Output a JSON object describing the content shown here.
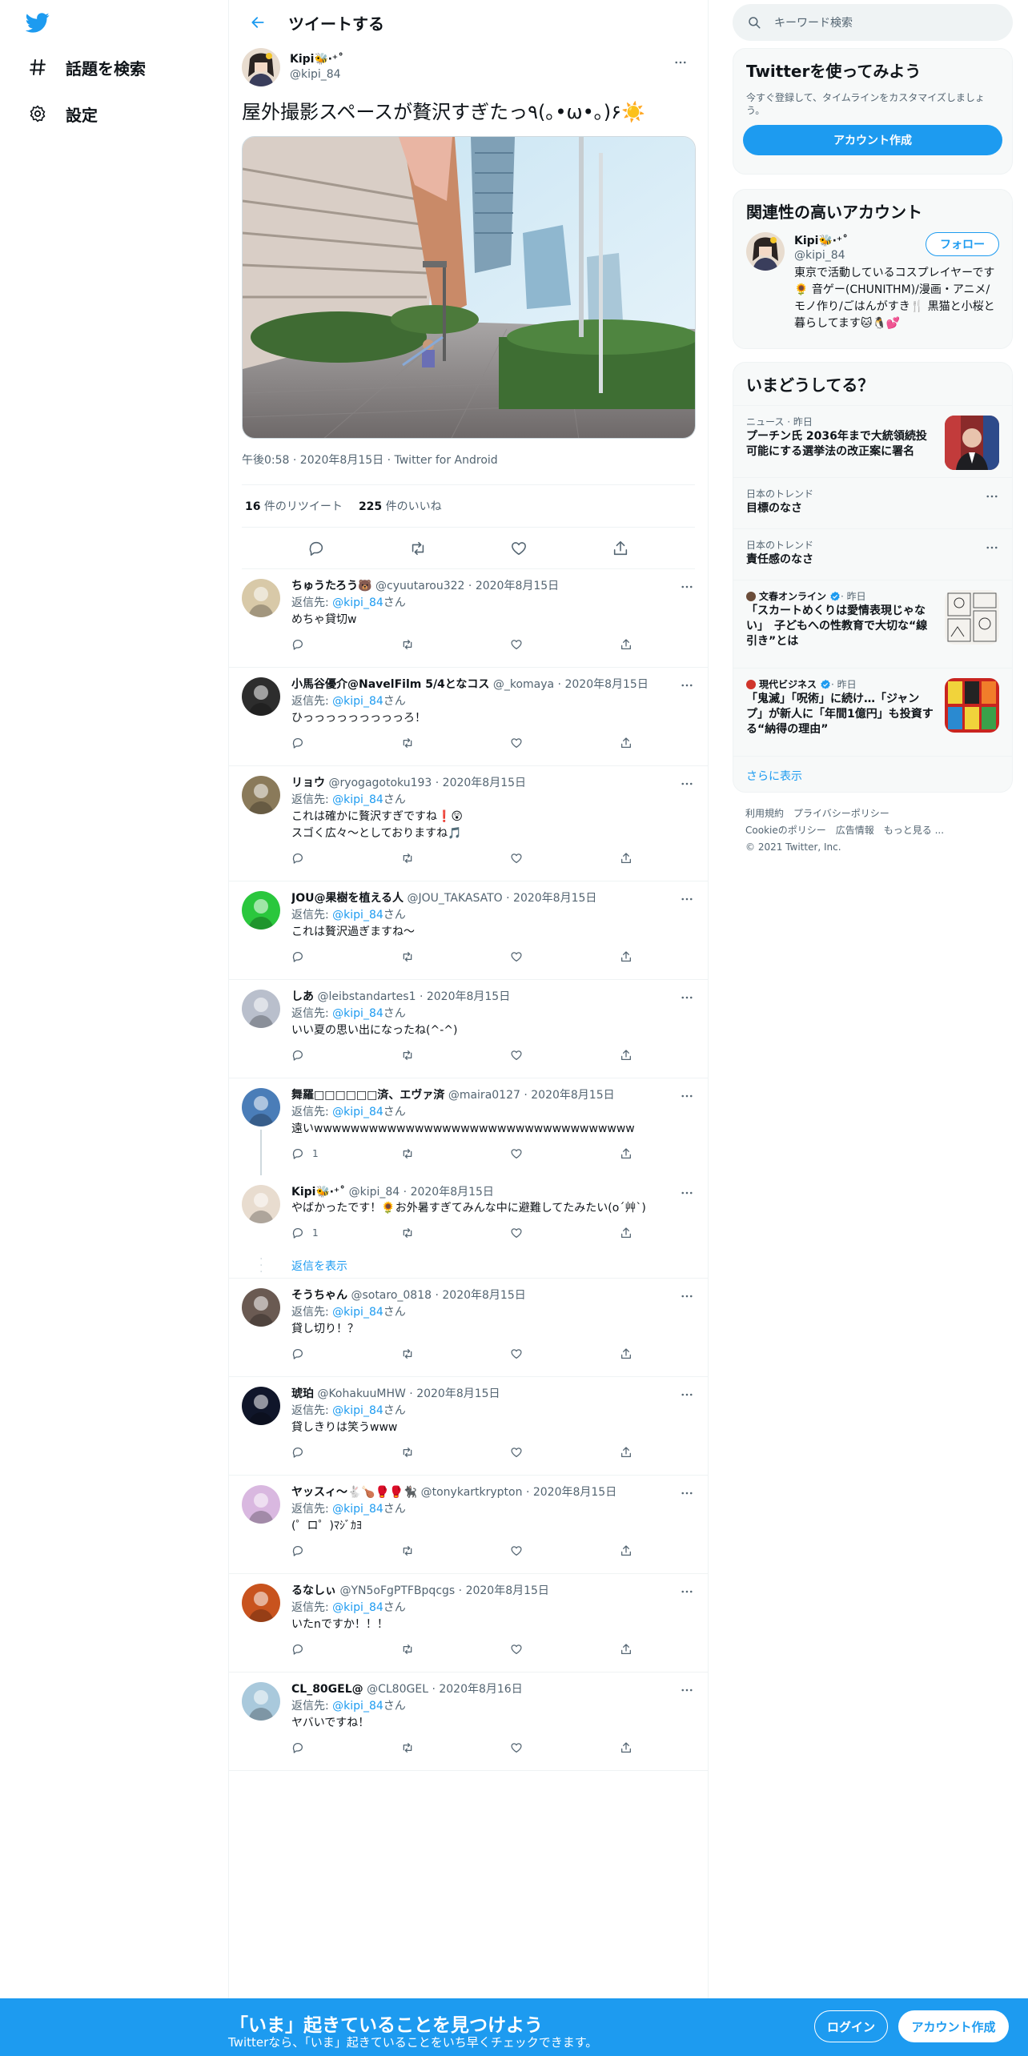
{
  "nav": {
    "logo_icon": "twitter-bird-icon",
    "explore_label": "話題を検索",
    "settings_label": "設定"
  },
  "header": {
    "title": "ツイートする"
  },
  "tweet": {
    "author_name": "Kipi🐝‧⁺˚",
    "author_handle": "@kipi_84",
    "text": "屋外撮影スペースが贅沢すぎたっ٩(｡•ω•｡)۶☀️",
    "meta": "午後0:58 · 2020年8月15日 · Twitter for Android",
    "retweet_count": "16",
    "retweet_label": " 件のリツイート",
    "like_count": "225",
    "like_label": " 件のいいね"
  },
  "replies": [
    {
      "name": "ちゅうたろう🐻",
      "handle": "@cyuutarou322",
      "date": "2020年8月15日",
      "to_prefix": "返信先: ",
      "to_link": "@kipi_84",
      "to_suffix": "さん",
      "text": "めちゃ貸切w",
      "reply_count": ""
    },
    {
      "name": "小馬谷優介@NavelFilm 5/4となコス",
      "handle": "@_komaya",
      "date": "2020年8月15日",
      "to_prefix": "返信先: ",
      "to_link": "@kipi_84",
      "to_suffix": "さん",
      "text": "ひっっっっっっっっっろ！",
      "reply_count": ""
    },
    {
      "name": "リョウ",
      "handle": "@ryogagotoku193",
      "date": "2020年8月15日",
      "to_prefix": "返信先: ",
      "to_link": "@kipi_84",
      "to_suffix": "さん",
      "text": "これは確かに贅沢すぎですね❗😲\nスゴく広々～としておりますね🎵",
      "reply_count": ""
    },
    {
      "name": "JOU@果樹を植える人",
      "handle": "@JOU_TAKASATO",
      "date": "2020年8月15日",
      "to_prefix": "返信先: ",
      "to_link": "@kipi_84",
      "to_suffix": "さん",
      "text": "これは贅沢過ぎますね〜",
      "reply_count": ""
    },
    {
      "name": "しあ",
      "handle": "@leibstandartes1",
      "date": "2020年8月15日",
      "to_prefix": "返信先: ",
      "to_link": "@kipi_84",
      "to_suffix": "さん",
      "text": "いい夏の思い出になったね(^-^)",
      "reply_count": ""
    },
    {
      "name": "舞羅□□□□□□済、エヴァ済",
      "handle": "@maira0127",
      "date": "2020年8月15日",
      "to_prefix": "返信先: ",
      "to_link": "@kipi_84",
      "to_suffix": "さん",
      "text": "遠いwwwwwwwwwwwwwwwwwwwwwwwwwwwwwwwwwww",
      "reply_count": "1"
    },
    {
      "name": "Kipi🐝‧⁺˚",
      "handle": "@kipi_84",
      "date": "2020年8月15日",
      "to_prefix": "",
      "to_link": "",
      "to_suffix": "",
      "text": "やばかったです！🌻お外暑すぎてみんな中に避難してたみたい(o´艸`)",
      "reply_count": "1"
    },
    {
      "name": "そうちゃん",
      "handle": "@sotaro_0818",
      "date": "2020年8月15日",
      "to_prefix": "返信先: ",
      "to_link": "@kipi_84",
      "to_suffix": "さん",
      "text": "貸し切り！？",
      "reply_count": ""
    },
    {
      "name": "琥珀",
      "handle": "@KohakuuMHW",
      "date": "2020年8月15日",
      "to_prefix": "返信先: ",
      "to_link": "@kipi_84",
      "to_suffix": "さん",
      "text": "貸しきりは笑うwww",
      "reply_count": ""
    },
    {
      "name": "ヤッスィ～🐇🍗🥊🥊🐈‍⬛",
      "handle": "@tonykartkrypton",
      "date": "2020年8月15日",
      "to_prefix": "返信先: ",
      "to_link": "@kipi_84",
      "to_suffix": "さん",
      "text": "(゜ロ゜)ﾏｼﾞｶﾖ",
      "reply_count": ""
    },
    {
      "name": "るなしぃ",
      "handle": "@YN5oFgPTFBpqcgs",
      "date": "2020年8月15日",
      "to_prefix": "返信先: ",
      "to_link": "@kipi_84",
      "to_suffix": "さん",
      "text": "いたnですか！！！",
      "reply_count": ""
    },
    {
      "name": "CL_80GEL@",
      "handle": "@CL80GEL",
      "date": "2020年8月16日",
      "to_prefix": "返信先: ",
      "to_link": "@kipi_84",
      "to_suffix": "さん",
      "text": "ヤバいですね！",
      "reply_count": ""
    }
  ],
  "show_replies_label": "返信を表示",
  "search": {
    "placeholder": "キーワード検索"
  },
  "signup_panel": {
    "title": "Twitterを使ってみよう",
    "desc": "今すぐ登録して、タイムラインをカスタマイズしましょう。",
    "button": "アカウント作成"
  },
  "related": {
    "title": "関連性の高いアカウント",
    "name": "Kipi🐝‧⁺˚",
    "handle": "@kipi_84",
    "bio": "東京で活動しているコスプレイヤーです🌻 音ゲー(CHUNITHM)/漫画・アニメ/モノ作り/ごはんがすき🍴 黒猫と小桜と暮らしてます🐱🐧💕",
    "follow": "フォロー"
  },
  "trends": {
    "title": "いまどうしてる？",
    "items": [
      {
        "meta": "ニュース · 昨日",
        "title": "プーチン氏 2036年まで大統領続投可能にする選挙法の改正案に署名"
      },
      {
        "meta": "日本のトレンド",
        "title": "目標のなさ"
      },
      {
        "meta": "日本のトレンド",
        "title": "責任感のなさ"
      },
      {
        "meta_source": "文春オンライン",
        "meta_time": " · 昨日",
        "title": "「スカートめくりは愛情表現じゃない」　子どもへの性教育で大切な“線引き”とは"
      },
      {
        "meta_source": "現代ビジネス",
        "meta_time": " · 昨日",
        "title": "「鬼滅」「呪術」に続け…「ジャンプ」が新人に「年間1億円」も投資する“納得の理由”"
      }
    ],
    "show_more": "さらに表示"
  },
  "footer": {
    "terms": "利用規約",
    "privacy": "プライバシーポリシー",
    "cookie": "Cookieのポリシー",
    "ads": "広告情報",
    "more": "もっと見る ...",
    "copyright": "© 2021 Twitter, Inc."
  },
  "bottombar": {
    "title": "「いま」起きていることを見つけよう",
    "subtitle": "Twitterなら、「いま」起きていることをいち早くチェックできます。",
    "login": "ログイン",
    "signup": "アカウント作成"
  },
  "colors": {
    "accent": "#1d9bf0",
    "text": "#0f1419",
    "muted": "#536471",
    "border": "#eff3f4"
  }
}
